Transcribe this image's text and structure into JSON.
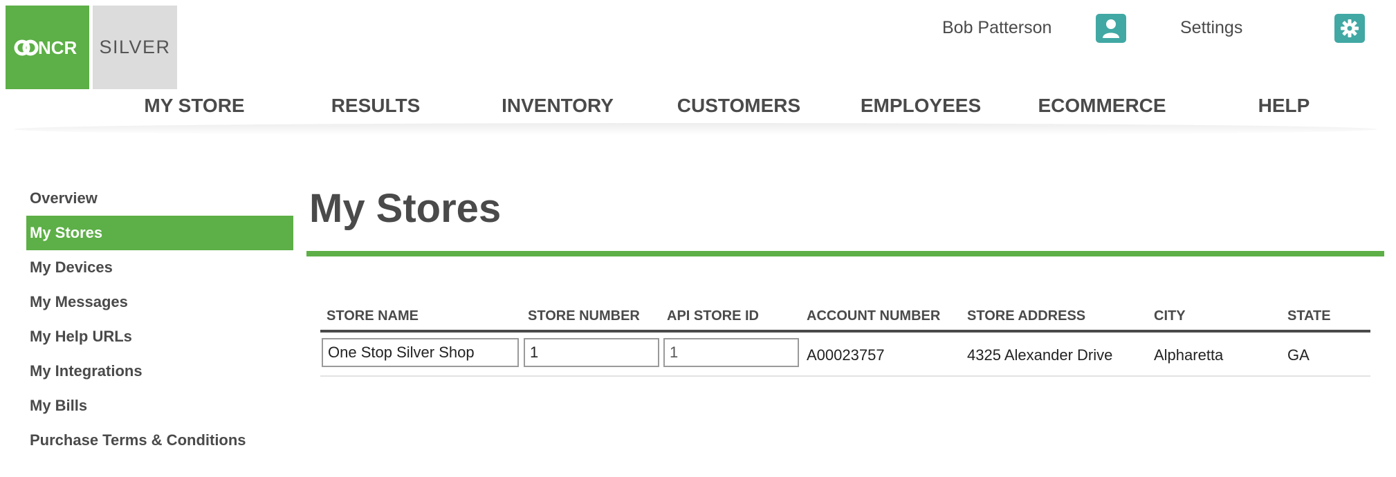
{
  "brand": {
    "primary": "NCR",
    "product": "SILVER",
    "accent_color": "#5daf47",
    "teal_color": "#41a8a4"
  },
  "header": {
    "user_name": "Bob Patterson",
    "user_icon": "user-icon",
    "settings_label": "Settings",
    "settings_icon": "gear-icon"
  },
  "nav": {
    "items": [
      "MY STORE",
      "RESULTS",
      "INVENTORY",
      "CUSTOMERS",
      "EMPLOYEES",
      "ECOMMERCE",
      "HELP"
    ]
  },
  "sidebar": {
    "items": [
      "Overview",
      "My Stores",
      "My Devices",
      "My Messages",
      "My Help URLs",
      "My Integrations",
      "My Bills",
      "Purchase Terms & Conditions"
    ],
    "active": "My Stores"
  },
  "page": {
    "title": "My Stores"
  },
  "table": {
    "headers": [
      "STORE NAME",
      "STORE NUMBER",
      "API STORE ID",
      "ACCOUNT NUMBER",
      "STORE ADDRESS",
      "CITY",
      "STATE"
    ],
    "rows": [
      {
        "store_name": "One Stop Silver Shop",
        "store_number": "1",
        "api_store_id": "1",
        "account_number": "A00023757",
        "store_address": "4325 Alexander Drive",
        "city": "Alpharetta",
        "state": "GA"
      }
    ]
  }
}
